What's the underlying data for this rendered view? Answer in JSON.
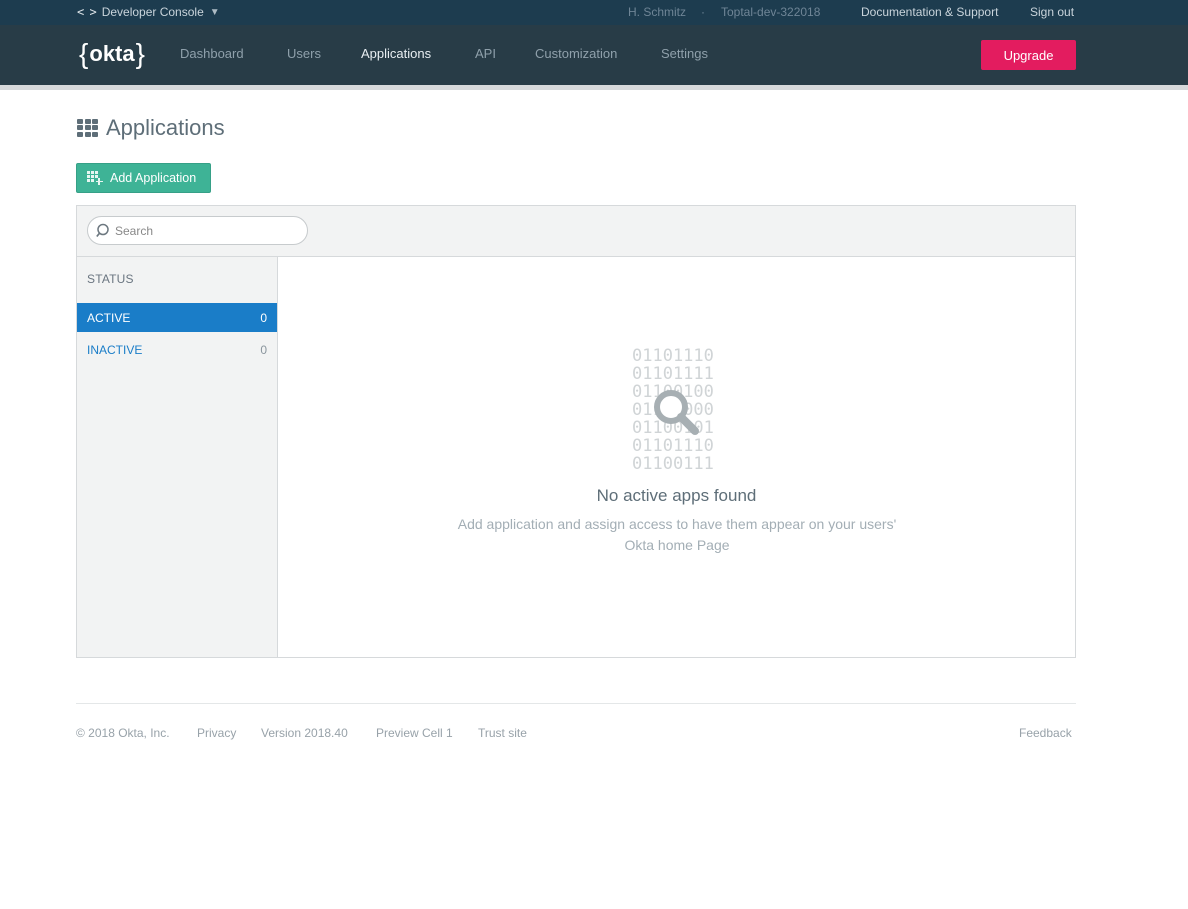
{
  "topbar": {
    "console_label": "Developer Console",
    "console_caret": "▼",
    "code_glyph": "< >",
    "user_name": "H. Schmitz",
    "separator": "·",
    "org_name": "Toptal-dev-322018",
    "docs_link": "Documentation & Support",
    "signout_link": "Sign out"
  },
  "nav": {
    "logo_text": "okta",
    "items": [
      {
        "label": "Dashboard",
        "active": false
      },
      {
        "label": "Users",
        "active": false
      },
      {
        "label": "Applications",
        "active": true
      },
      {
        "label": "API",
        "active": false
      },
      {
        "label": "Customization",
        "active": false
      },
      {
        "label": "Settings",
        "active": false
      }
    ],
    "upgrade_label": "Upgrade"
  },
  "page": {
    "title": "Applications",
    "add_button_label": "Add Application"
  },
  "search": {
    "placeholder": "Search"
  },
  "sidebar": {
    "heading": "STATUS",
    "filters": [
      {
        "label": "ACTIVE",
        "count": "0",
        "selected": true
      },
      {
        "label": "INACTIVE",
        "count": "0",
        "selected": false
      }
    ]
  },
  "empty_state": {
    "binary_lines": [
      "01101110",
      "01101111",
      "01100100",
      "01100000",
      "01100101",
      "01101110",
      "01100111"
    ],
    "title": "No active apps found",
    "description": "Add application and assign access to have them appear on your users' Okta home Page"
  },
  "footer": {
    "copyright": "© 2018 Okta, Inc.",
    "privacy": "Privacy",
    "version": "Version 2018.40",
    "cell": "Preview Cell 1",
    "trust": "Trust site",
    "feedback": "Feedback"
  },
  "colors": {
    "topbar_bg": "#1d3c4f",
    "navbar_bg": "#283c47",
    "upgrade_bg": "#e31c5f",
    "add_button_bg": "#3eb396",
    "active_filter_bg": "#1a7dc8"
  }
}
